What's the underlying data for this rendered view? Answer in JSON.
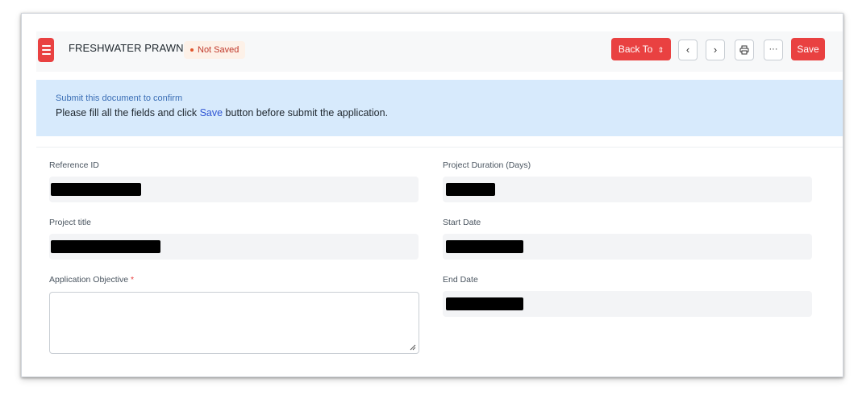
{
  "header": {
    "title": "FRESHWATER PRAWN",
    "status": "Not Saved",
    "back_to_label": "Back To",
    "back_to_icon": "up-down-chevron",
    "prev_icon": "chevron-left-icon",
    "next_icon": "chevron-right-icon",
    "print_icon": "printer-icon",
    "more_label": "···",
    "save_label": "Save"
  },
  "notice": {
    "line1": "Submit this document to confirm",
    "line2_before": "Please fill all the fields and click ",
    "line2_link": "Save",
    "line2_after": " button before submit the application."
  },
  "form": {
    "left": [
      {
        "label": "Reference ID",
        "value": "[redacted]"
      },
      {
        "label": "Project title",
        "value": "[redacted]"
      },
      {
        "label": "Application Objective",
        "required_mark": "*",
        "value": ""
      }
    ],
    "right": [
      {
        "label": "Project Duration (Days)",
        "value": "[redacted]"
      },
      {
        "label": "Start Date",
        "value": "[redacted]"
      },
      {
        "label": "End Date",
        "value": "[redacted]"
      }
    ]
  },
  "colors": {
    "accent_red": "#e94141",
    "notice_bg": "#d7eafc",
    "link_blue": "#2f55d4"
  }
}
